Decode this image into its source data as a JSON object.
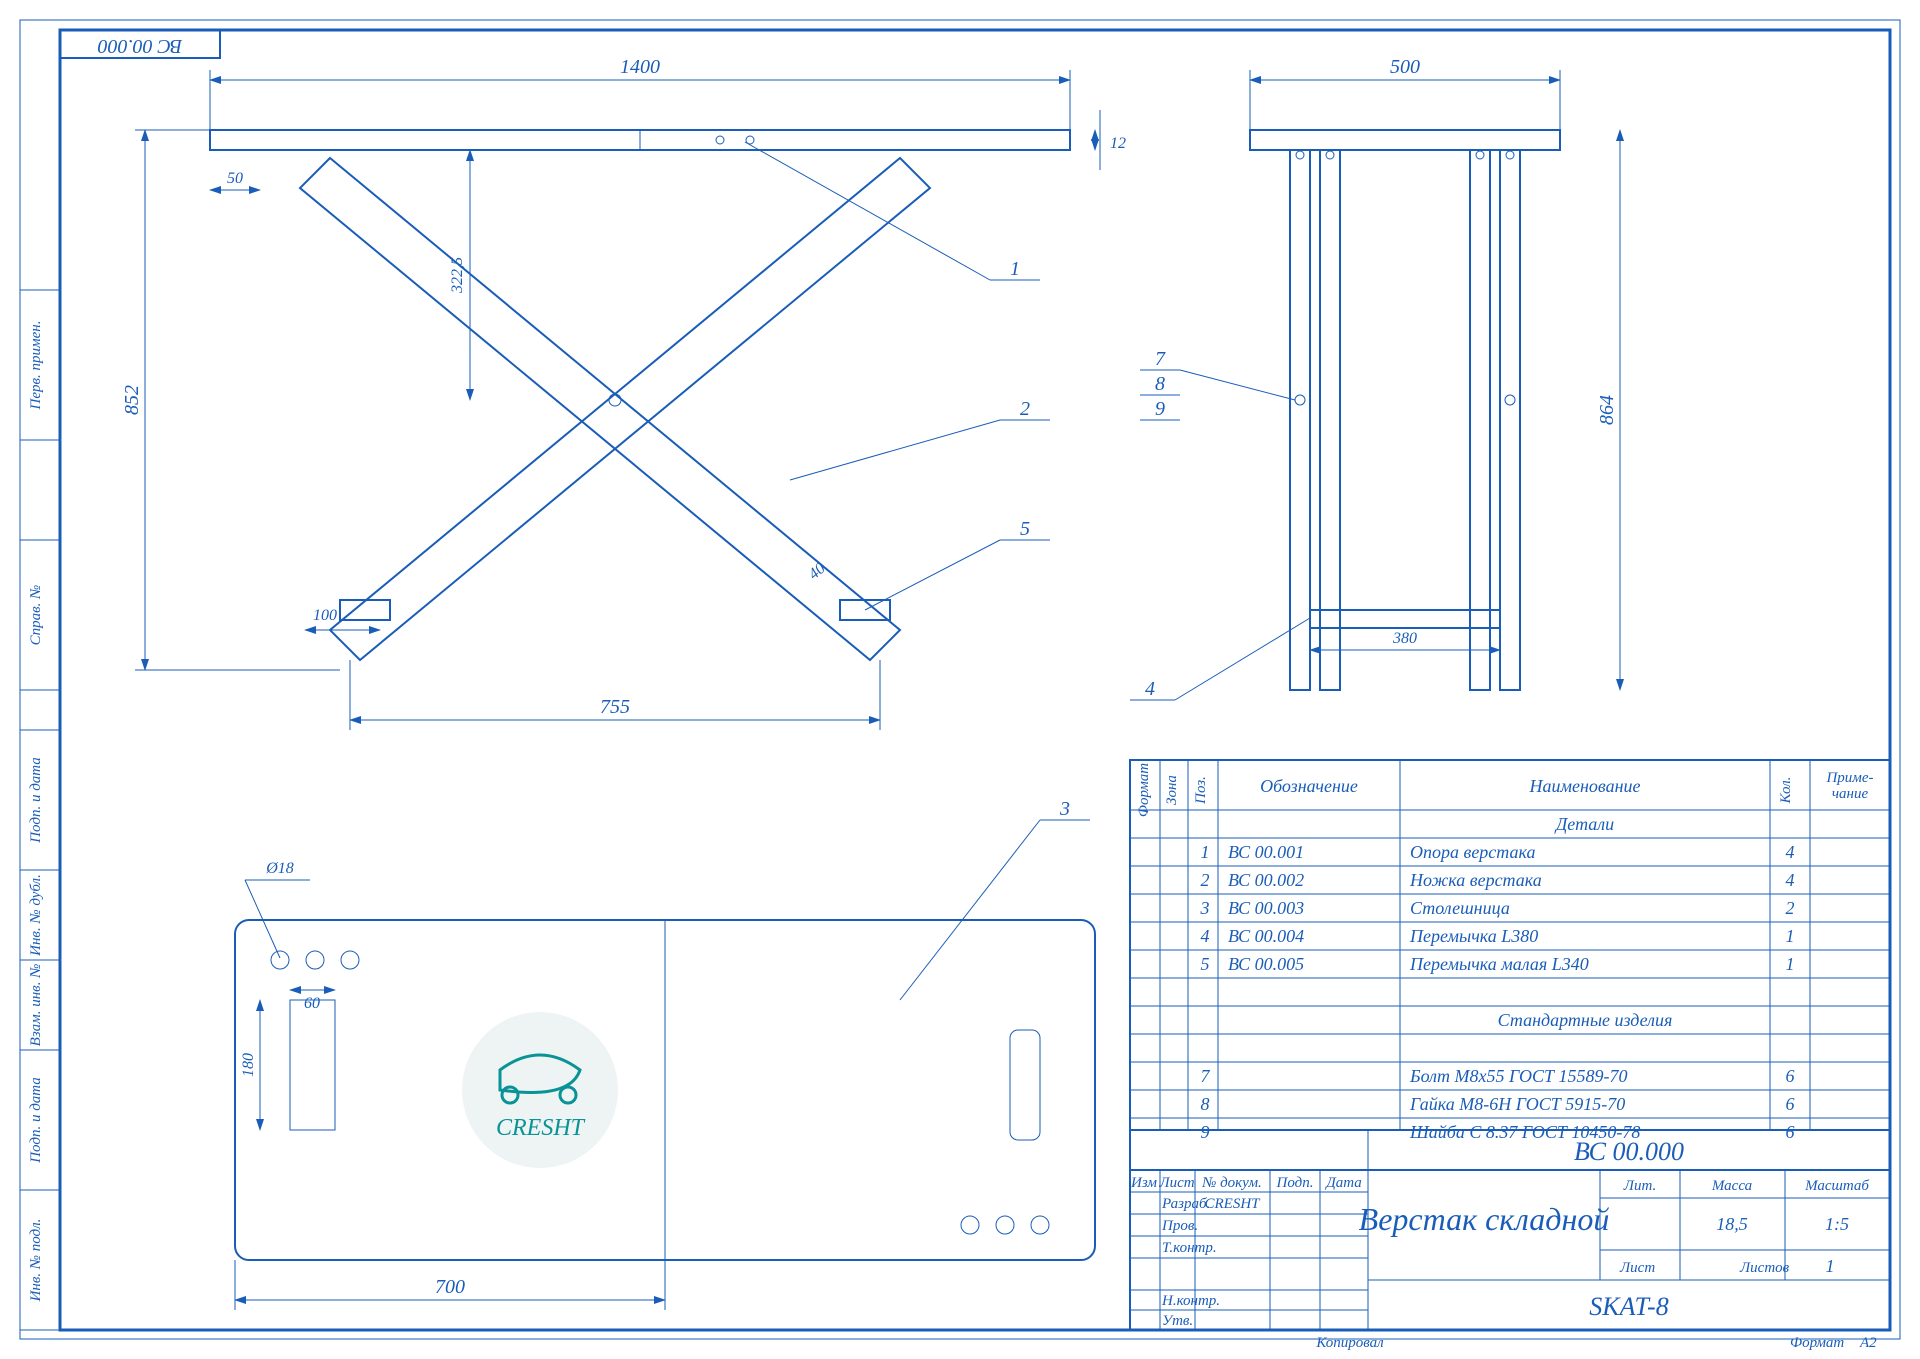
{
  "frame_code": "ВС 00.000",
  "dims": {
    "w1400": "1400",
    "w500": "500",
    "h852": "852",
    "h864": "864",
    "t12": "12",
    "h3225": "322,5",
    "off50": "50",
    "foot100": "100",
    "span755": "755",
    "leg40": "40",
    "w700": "700",
    "dia18": "Ø18",
    "g60": "60",
    "g180": "180",
    "w380": "380"
  },
  "leaders": {
    "p1": "1",
    "p2": "2",
    "p3": "3",
    "p4": "4",
    "p5": "5",
    "p7": "7",
    "p8": "8",
    "p9": "9"
  },
  "bom": {
    "cols": {
      "fmt": "Формат",
      "zone": "Зона",
      "pos": "Поз.",
      "desig": "Обозначение",
      "name": "Наименование",
      "qty": "Кол.",
      "note": "Приме-\nчание"
    },
    "section_parts": "Детали",
    "section_std": "Стандартные изделия",
    "rows": [
      {
        "pos": "1",
        "desig": "ВС 00.001",
        "name": "Опора верстака",
        "qty": "4"
      },
      {
        "pos": "2",
        "desig": "ВС 00.002",
        "name": "Ножка верстака",
        "qty": "4"
      },
      {
        "pos": "3",
        "desig": "ВС 00.003",
        "name": "Столешница",
        "qty": "2"
      },
      {
        "pos": "4",
        "desig": "ВС 00.004",
        "name": "Перемычка L380",
        "qty": "1"
      },
      {
        "pos": "5",
        "desig": "ВС 00.005",
        "name": "Перемычка малая L340",
        "qty": "1"
      }
    ],
    "std": [
      {
        "pos": "7",
        "name": "Болт М8х55 ГОСТ 15589-70",
        "qty": "6"
      },
      {
        "pos": "8",
        "name": "Гайка М8-6Н ГОСТ 5915-70",
        "qty": "6"
      },
      {
        "pos": "9",
        "name": "Шайба С 8.37 ГОСТ 10450-78",
        "qty": "6"
      }
    ]
  },
  "tb": {
    "docnum": "ВС 00.000",
    "title": "Верстак складной",
    "project": "SKAT-8",
    "row_labels": {
      "izm": "Изм",
      "list": "Лист",
      "ndoc": "№ докум.",
      "sign": "Подп.",
      "date": "Дата",
      "razrab": "Разраб.",
      "prov": "Пров.",
      "tkontr": "Т.контр.",
      "nkontr": "Н.контр.",
      "utv": "Утв."
    },
    "razrab_val": "CRESHT",
    "tblcols": {
      "lit": "Лит.",
      "mass": "Масса",
      "scale": "Масштаб",
      "list2": "Лист",
      "sheets": "Листов"
    },
    "mass": "18,5",
    "scale": "1:5",
    "sheets": "1",
    "footer": {
      "kopiroval": "Копировал",
      "format": "Формат",
      "fval": "А2"
    }
  },
  "left_labels": {
    "inv_podl": "Инв. № подл.",
    "podp_data": "Подп. и дата",
    "vzam_inv": "Взам. инв. №",
    "inv_dubl": "Инв. № дубл.",
    "podp_data2": "Подп. и дата",
    "sprav": "Справ. №",
    "perv": "Перв. примен."
  },
  "logo": "CRESHT"
}
